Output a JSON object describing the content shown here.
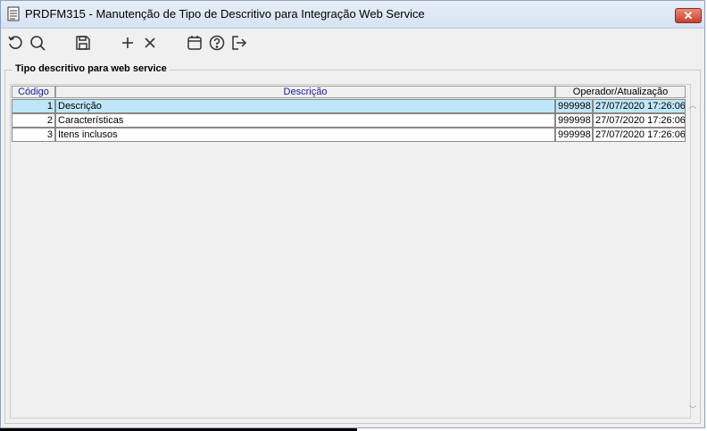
{
  "window": {
    "title": "PRDFM315 - Manutenção de Tipo de Descritivo para Integração Web Service",
    "close_label": "✕"
  },
  "toolbar": {
    "buttons": [
      {
        "name": "refresh-icon",
        "icon": "refresh"
      },
      {
        "name": "search-icon",
        "icon": "search"
      },
      {
        "name": "save-icon",
        "icon": "save"
      },
      {
        "name": "add-icon",
        "icon": "plus"
      },
      {
        "name": "delete-icon",
        "icon": "close"
      },
      {
        "name": "calendar-icon",
        "icon": "calendar"
      },
      {
        "name": "help-icon",
        "icon": "question"
      },
      {
        "name": "exit-icon",
        "icon": "exit"
      }
    ]
  },
  "group": {
    "label": "Tipo descritivo para web service"
  },
  "grid": {
    "columns": {
      "codigo": "Código",
      "descricao": "Descrição",
      "operador": "Operador/Atualização"
    },
    "rows": [
      {
        "codigo": "1",
        "descricao": "Descrição",
        "operador": "999998",
        "atualizacao": "27/07/2020 17:26:06",
        "selected": true
      },
      {
        "codigo": "2",
        "descricao": "Características",
        "operador": "999998",
        "atualizacao": "27/07/2020 17:26:06",
        "selected": false
      },
      {
        "codigo": "3",
        "descricao": "Itens inclusos",
        "operador": "999998",
        "atualizacao": "27/07/2020 17:26:06",
        "selected": false
      }
    ]
  },
  "colors": {
    "selected_row": "#bfe6f8",
    "header_text": "#1a1aa0",
    "close_button": "#c7402a"
  }
}
